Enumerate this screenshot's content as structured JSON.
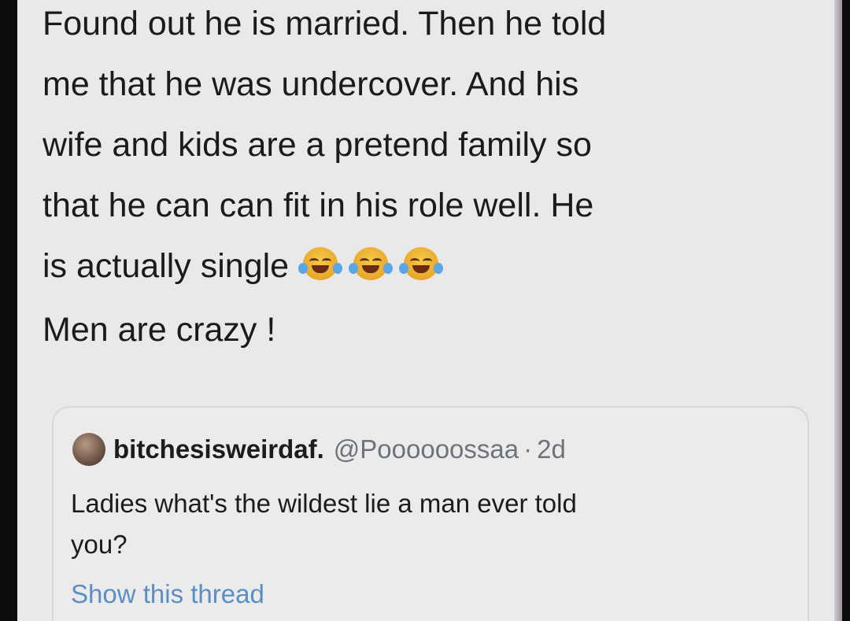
{
  "tweet": {
    "lines": [
      "Found out he is married. Then he told",
      "me that he was undercover. And his",
      "wife and kids are a pretend family so",
      "that he can can fit in his role well. He",
      "is actually single",
      "Men are crazy !"
    ],
    "emojis": [
      "face-with-tears-of-joy",
      "face-with-tears-of-joy",
      "face-with-tears-of-joy"
    ]
  },
  "quoted_tweet": {
    "display_name": "bitchesisweirdaf.",
    "handle": "@Poooooossaa",
    "separator": "·",
    "age": "2d",
    "text_line1": "Ladies what's the wildest lie a man ever told",
    "text_line2": "you?",
    "show_thread": "Show this thread"
  },
  "colors": {
    "background": "#e9e9e9",
    "text": "#1b1b1b",
    "muted": "#6e737a",
    "link": "#5b8fc4"
  }
}
